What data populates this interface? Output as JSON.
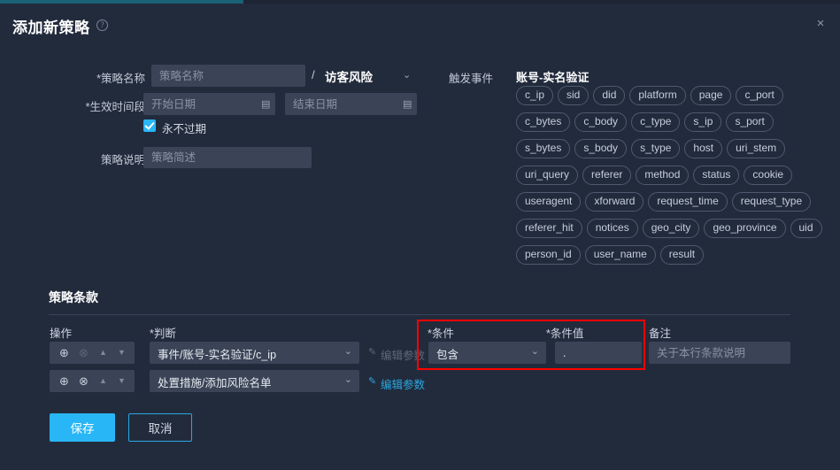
{
  "window": {
    "title": "添加新策略",
    "help_icon": "question-mark-icon",
    "close_icon": "×",
    "progress_percent": 29
  },
  "form": {
    "policy_name": {
      "label": "*策略名称",
      "placeholder": "策略名称",
      "value": "",
      "separator": "/",
      "category_value": "访客风险",
      "caret": "⌄"
    },
    "effective_period": {
      "label": "*生效时间段",
      "start_placeholder": "开始日期",
      "start_value": "",
      "end_placeholder": "结束日期",
      "end_value": "",
      "calendar_icon": "▤"
    },
    "never_expire": {
      "label": "永不过期",
      "checked": true
    },
    "description": {
      "label": "策略说明",
      "placeholder": "策略简述",
      "value": ""
    }
  },
  "trigger": {
    "label": "触发事件",
    "value": "账号-实名验证",
    "tags": [
      "c_ip",
      "sid",
      "did",
      "platform",
      "page",
      "c_port",
      "c_bytes",
      "c_body",
      "c_type",
      "s_ip",
      "s_port",
      "s_bytes",
      "s_body",
      "s_type",
      "host",
      "uri_stem",
      "uri_query",
      "referer",
      "method",
      "status",
      "cookie",
      "useragent",
      "xforward",
      "request_time",
      "request_type",
      "referer_hit",
      "notices",
      "geo_city",
      "geo_province",
      "uid",
      "person_id",
      "user_name",
      "result"
    ]
  },
  "terms": {
    "section_title": "策略条款",
    "columns": {
      "operation": "操作",
      "judgement": "*判断",
      "condition": "*条件",
      "condition_value": "*条件值",
      "remark": "备注"
    },
    "op_icons": {
      "add": "⊕",
      "remove": "⊗",
      "up": "▲",
      "down": "▼"
    },
    "rows": [
      {
        "judgement": "事件/账号-实名验证/c_ip",
        "edit_params_label": "编辑参数",
        "edit_params_enabled": false,
        "condition": "包含",
        "condition_value": ".",
        "remark_placeholder": "关于本行条款说明",
        "remark_value": "",
        "remove_enabled": false,
        "has_condition_cells": true
      },
      {
        "judgement": "处置措施/添加风险名单",
        "edit_params_label": "编辑参数",
        "edit_params_enabled": true,
        "condition": "",
        "condition_value": "",
        "remark_placeholder": "",
        "remark_value": "",
        "remove_enabled": true,
        "has_condition_cells": false
      }
    ],
    "pen_icon": "✎",
    "caret_icon": "⌄"
  },
  "footer": {
    "save_label": "保存",
    "cancel_label": "取消"
  },
  "colors": {
    "accent": "#29b6f6",
    "link": "#29a8e0",
    "highlight": "#ff0000",
    "field_bg": "#3a4456",
    "page_bg": "#222b3c",
    "progress": "#1b6277"
  }
}
